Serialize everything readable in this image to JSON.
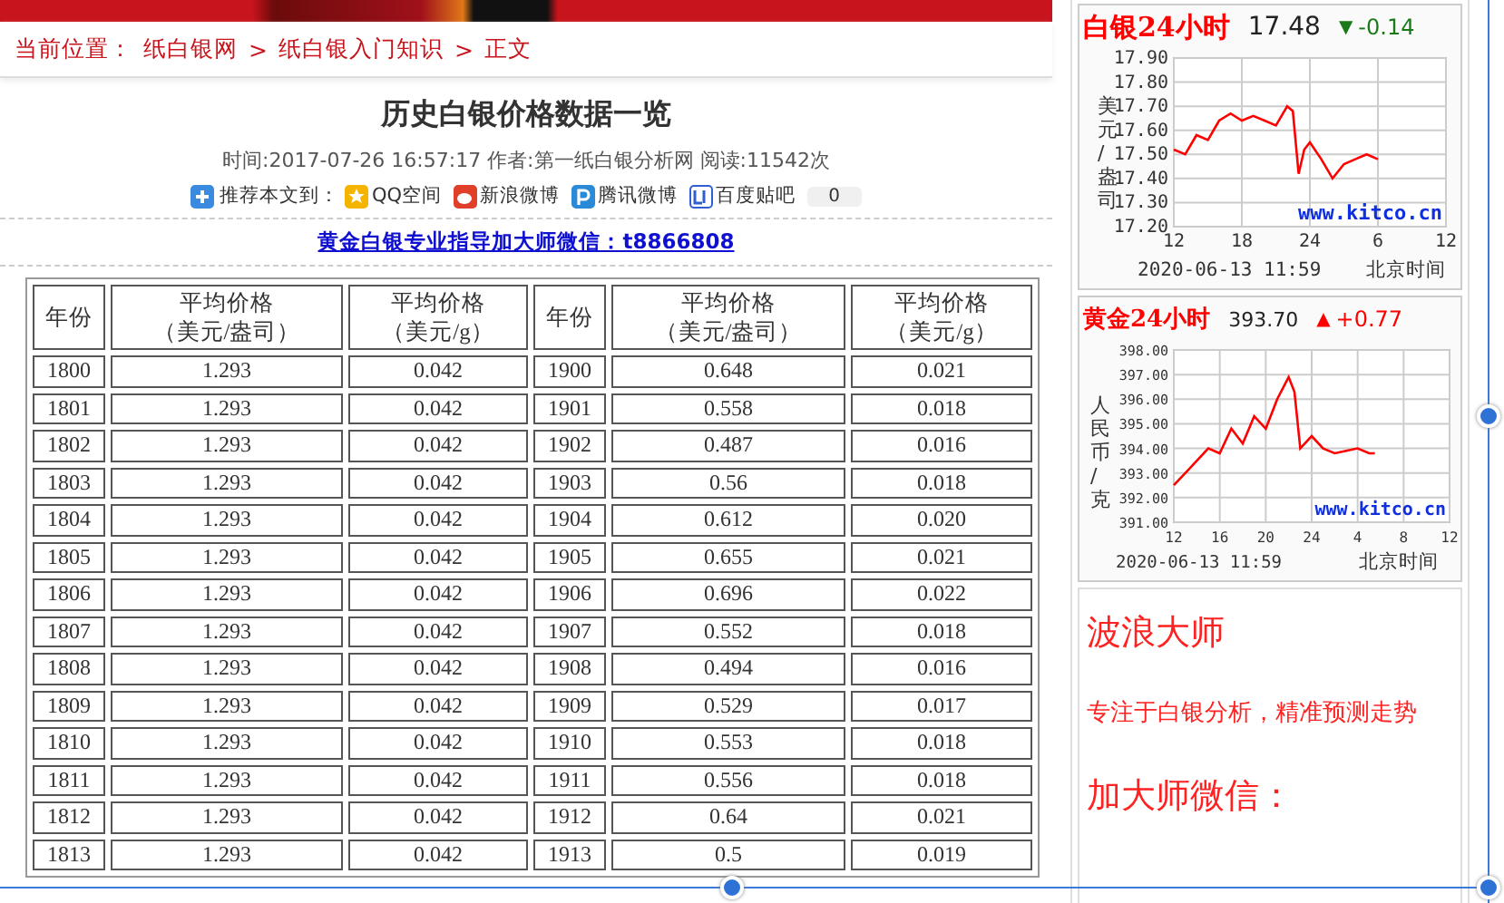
{
  "breadcrumb": {
    "label": "当前位置：",
    "items": [
      "纸白银网",
      "纸白银入门知识",
      "正文"
    ],
    "separators": [
      ">",
      ">"
    ]
  },
  "article": {
    "title": "历史白银价格数据一览",
    "meta": "时间:2017-07-26 16:57:17 作者:第一纸白银分析网 阅读:11542次",
    "share": {
      "label": "推荐本文到：",
      "items": [
        {
          "label": "QQ空间",
          "kind": "qzone"
        },
        {
          "label": "新浪微博",
          "kind": "weibo"
        },
        {
          "label": "腾讯微博",
          "kind": "tencent"
        },
        {
          "label": "百度贴吧",
          "kind": "tieba"
        }
      ],
      "count": "0"
    },
    "promo_link": "黄金白银专业指导加大师微信：t8866808"
  },
  "table": {
    "columns": [
      {
        "label": "年份"
      },
      {
        "label": "平均价格",
        "unit": "（美元/盎司）"
      },
      {
        "label": "平均价格",
        "unit": "（美元/g）"
      },
      {
        "label": "年份"
      },
      {
        "label": "平均价格",
        "unit": "（美元/盎司）"
      },
      {
        "label": "平均价格",
        "unit": "（美元/g）"
      }
    ],
    "rows": [
      [
        "1800",
        "1.293",
        "0.042",
        "1900",
        "0.648",
        "0.021"
      ],
      [
        "1801",
        "1.293",
        "0.042",
        "1901",
        "0.558",
        "0.018"
      ],
      [
        "1802",
        "1.293",
        "0.042",
        "1902",
        "0.487",
        "0.016"
      ],
      [
        "1803",
        "1.293",
        "0.042",
        "1903",
        "0.56",
        "0.018"
      ],
      [
        "1804",
        "1.293",
        "0.042",
        "1904",
        "0.612",
        "0.020"
      ],
      [
        "1805",
        "1.293",
        "0.042",
        "1905",
        "0.655",
        "0.021"
      ],
      [
        "1806",
        "1.293",
        "0.042",
        "1906",
        "0.696",
        "0.022"
      ],
      [
        "1807",
        "1.293",
        "0.042",
        "1907",
        "0.552",
        "0.018"
      ],
      [
        "1808",
        "1.293",
        "0.042",
        "1908",
        "0.494",
        "0.016"
      ],
      [
        "1809",
        "1.293",
        "0.042",
        "1909",
        "0.529",
        "0.017"
      ],
      [
        "1810",
        "1.293",
        "0.042",
        "1910",
        "0.553",
        "0.018"
      ],
      [
        "1811",
        "1.293",
        "0.042",
        "1911",
        "0.556",
        "0.018"
      ],
      [
        "1812",
        "1.293",
        "0.042",
        "1912",
        "0.64",
        "0.021"
      ],
      [
        "1813",
        "1.293",
        "0.042",
        "1913",
        "0.5",
        "0.019"
      ]
    ]
  },
  "sidebar": {
    "charts": [
      {
        "title": "白银24小时",
        "price": "17.48",
        "arrow": "▼",
        "change": "-0.14",
        "color": "#1a7a1a",
        "ylabel_text": "美元/盎司",
        "next_day_hour_labels": [
          "6",
          "12"
        ],
        "source_label": "www.kitco.cn",
        "date": "2020-06-13 11:59",
        "timezone": "北京时间",
        "chart_data": {
          "type": "line",
          "x": [
            12,
            13,
            14,
            15,
            16,
            17,
            18,
            19,
            20,
            21,
            22,
            22.5,
            23,
            23.5,
            24,
            25,
            26,
            27,
            28,
            29,
            30
          ],
          "series": [
            {
              "color": "#ff0000",
              "values": [
                17.52,
                17.5,
                17.58,
                17.56,
                17.64,
                17.67,
                17.64,
                17.66,
                17.64,
                17.62,
                17.7,
                17.68,
                17.42,
                17.52,
                17.55,
                17.48,
                17.4,
                17.46,
                17.48,
                17.5,
                17.48
              ]
            }
          ],
          "xlim": [
            12,
            36
          ],
          "ylim": [
            17.2,
            17.9
          ],
          "grid": true,
          "xticks": [
            12,
            18,
            24
          ],
          "yticks": [
            {
              "value": 17.2,
              "label": "17.20"
            },
            {
              "value": 17.3,
              "label": "17.30"
            },
            {
              "value": 17.4,
              "label": "17.40"
            },
            {
              "value": 17.5,
              "label": "17.50"
            },
            {
              "value": 17.6,
              "label": "17.60"
            },
            {
              "value": 17.7,
              "label": "17.70"
            },
            {
              "value": 17.8,
              "label": "17.80"
            },
            {
              "value": 17.9,
              "label": "17.90"
            }
          ]
        }
      },
      {
        "title": "黄金24小时",
        "price": "393.70",
        "arrow": "▲",
        "change": "+0.77",
        "color": "#ff0000",
        "ylabel_text": "人民币/克",
        "next_day_hour_labels": [
          "4",
          "8",
          "12"
        ],
        "source_label": "www.kitco.cn",
        "date": "2020-06-13 11:59",
        "timezone": "北京时间",
        "chart_data": {
          "type": "line",
          "x": [
            12,
            13,
            14,
            15,
            16,
            17,
            18,
            19,
            20,
            21,
            22,
            22.5,
            23,
            24,
            25,
            26,
            27,
            28,
            29,
            29.5
          ],
          "series": [
            {
              "color": "#ff0000",
              "values": [
                392.5,
                393,
                393.5,
                394,
                393.8,
                394.8,
                394.2,
                395.3,
                394.8,
                396,
                396.9,
                396.3,
                394,
                394.5,
                394,
                393.8,
                393.9,
                394,
                393.8,
                393.8
              ]
            }
          ],
          "xlim": [
            12,
            36
          ],
          "ylim": [
            391,
            398
          ],
          "grid": true,
          "xticks": [
            12,
            16,
            20,
            24
          ],
          "yticks": [
            {
              "value": 391,
              "label": "391.00"
            },
            {
              "value": 392,
              "label": "392.00"
            },
            {
              "value": 393,
              "label": "393.00"
            },
            {
              "value": 394,
              "label": "394.00"
            },
            {
              "value": 395,
              "label": "395.00"
            },
            {
              "value": 396,
              "label": "396.00"
            },
            {
              "value": 397,
              "label": "397.00"
            },
            {
              "value": 398,
              "label": "398.00"
            }
          ]
        }
      }
    ],
    "ad": {
      "lines": [
        "波浪大师",
        "专注于白银分析，精准预测走势",
        "加大师微信："
      ]
    }
  }
}
